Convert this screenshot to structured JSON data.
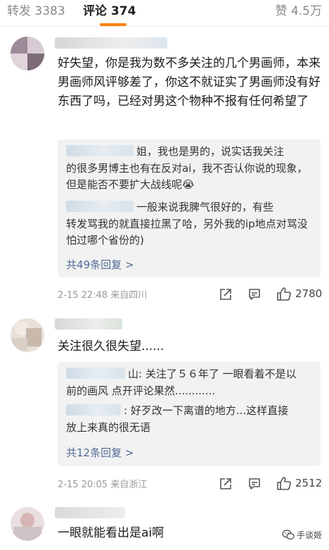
{
  "tabs": {
    "reposts": "转发 3383",
    "comments": "评论 374",
    "likes": "赞 4.5万"
  },
  "comments": [
    {
      "text": "好失望，你是我为数不多关注的几个男画师，本来男画师风评够差了，你这不就证实了男画师没有好东西了吗，已经对男这个物种不报有任何希望了",
      "replies": [
        {
          "line1": "姐，我也是男的，说实话我关注",
          "rest": "的很多男博主也有在反对ai，我不否认你说的现象，但是能否不要扩大战线呢😭"
        },
        {
          "line1": "一般来说我脾气很好的，有些",
          "rest": "转发骂我的就直接拉黑了哈，另外我的ip地点对骂没怕过哪个省份的)"
        }
      ],
      "more": "共49条回复 >",
      "time": "2-15 22:48",
      "location": "来自四川",
      "likes": "2780"
    },
    {
      "text": "关注很久很失望......",
      "replies": [
        {
          "line1": "山: 关注了５６年了 一眼看着不是以",
          "rest": "前的画风 点开评论果然............"
        },
        {
          "line1": ": 好歹改一下离谱的地方...这样直接",
          "rest": "放上来真的很无语"
        }
      ],
      "more": "共12条回复 >",
      "time": "2-15 20:05",
      "location": "来自浙江",
      "likes": "2512"
    },
    {
      "text": "一眼就能看出是ai啊"
    }
  ],
  "watermark": "手谈姬",
  "icons": {
    "share": "share-icon",
    "comment": "comment-icon",
    "like": "thumbs-up-icon",
    "watermark": "wechat-icon"
  },
  "colors": {
    "accent": "#ff8200",
    "link": "#506b96",
    "reply_bg": "#f2f2f2"
  }
}
